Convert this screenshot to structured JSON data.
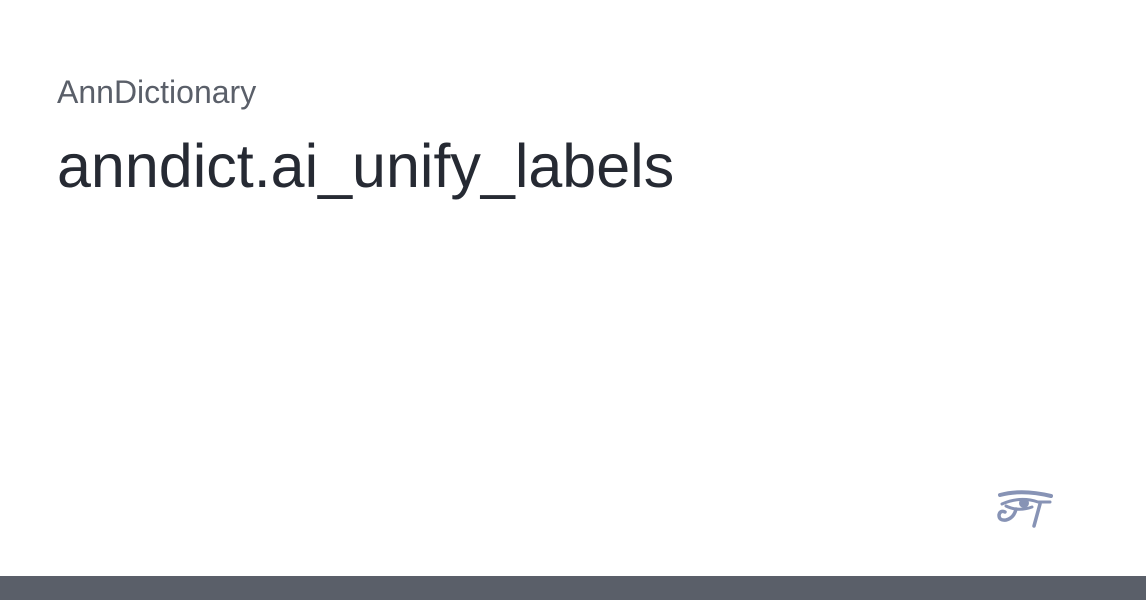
{
  "header": {
    "site_name": "AnnDictionary",
    "page_title": "anndict.ai_unify_labels"
  },
  "logo": {
    "icon": "eye-of-horus-icon",
    "color": "#8793b5"
  },
  "footer": {
    "color": "#5a5f69"
  }
}
